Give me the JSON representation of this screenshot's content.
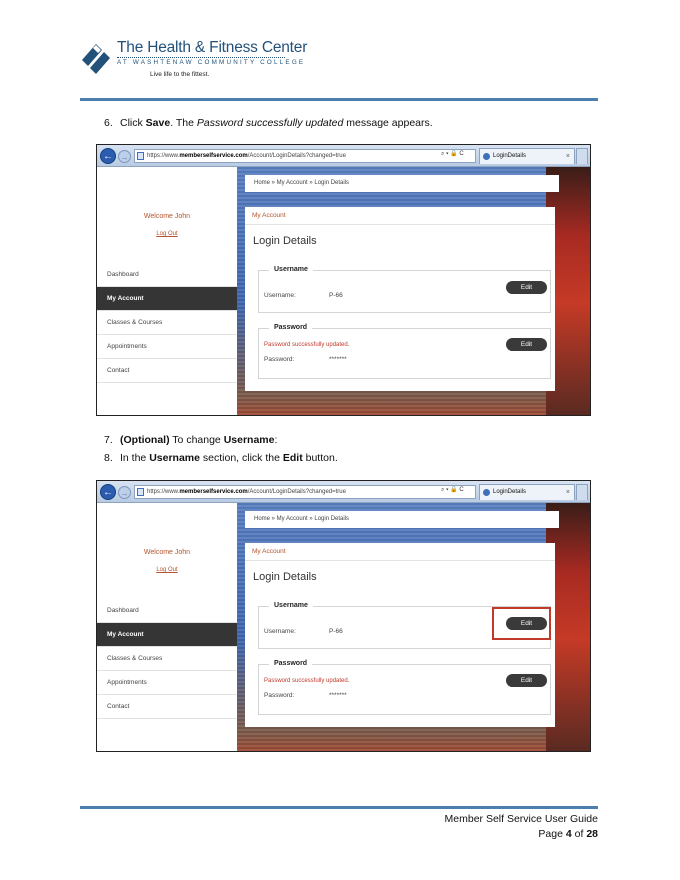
{
  "logo": {
    "title": "The Health & Fitness Center",
    "subtitle": "AT WASHTENAW COMMUNITY COLLEGE",
    "tagline": "Live life to the fittest.",
    "brand_color": "#23517a"
  },
  "steps": {
    "s6": {
      "num": "6.",
      "pre": "Click ",
      "bold": "Save",
      "mid": ".  The ",
      "italic": "Password successfully updated",
      "post": " message appears."
    },
    "s7": {
      "num": "7.",
      "bold1": "(Optional)",
      "mid": " To change ",
      "bold2": "Username",
      "post": ":"
    },
    "s8": {
      "num": "8.",
      "pre": "In the ",
      "bold1": "Username",
      "mid": " section, click the ",
      "bold2": "Edit",
      "post": " button."
    }
  },
  "browser": {
    "url_scheme": "https://www.",
    "url_host": "memberselfservice.com",
    "url_path": "/Account/LoginDetails?changed=true",
    "url_tools": "⌕ ▾ 🔒 C",
    "tab_title": "LoginDetails",
    "tab_close": "×"
  },
  "app": {
    "welcome": "Welcome John",
    "logout": "Log Out",
    "menu": [
      "Dashboard",
      "My Account",
      "Classes & Courses",
      "Appointments",
      "Contact"
    ],
    "active_menu": "My Account",
    "breadcrumb": "Home » My Account » Login Details",
    "panel_header": "My Account",
    "panel_title": "Login Details",
    "username_section": "Username",
    "username_label": "Username:",
    "username_value": "P-66",
    "password_section": "Password",
    "password_message": "Password successfully updated.",
    "password_label": "Password:",
    "password_value": "*******",
    "edit_label": "Edit",
    "accent_color": "#b4542b",
    "error_color": "#c0392b"
  },
  "footer": {
    "guide": "Member Self Service User Guide",
    "page_prefix": "Page ",
    "page_num": "4",
    "page_of": " of ",
    "page_total": "28"
  }
}
